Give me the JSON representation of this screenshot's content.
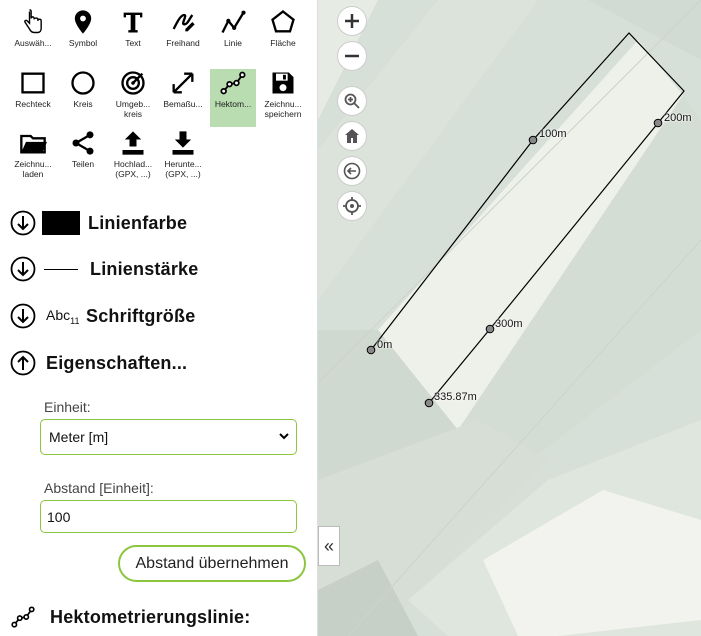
{
  "toolbar": {
    "tools": [
      {
        "id": "select",
        "label": "Auswäh...",
        "icon": "pointer-hand-icon"
      },
      {
        "id": "symbol",
        "label": "Symbol",
        "icon": "map-pin-icon"
      },
      {
        "id": "text",
        "label": "Text",
        "icon": "text-t-icon"
      },
      {
        "id": "freehand",
        "label": "Freihand",
        "icon": "freehand-icon"
      },
      {
        "id": "line",
        "label": "Linie",
        "icon": "polyline-icon"
      },
      {
        "id": "area",
        "label": "Fläche",
        "icon": "polygon-icon"
      },
      {
        "id": "rectangle",
        "label": "Rechteck",
        "icon": "rectangle-icon"
      },
      {
        "id": "circle",
        "label": "Kreis",
        "icon": "circle-icon"
      },
      {
        "id": "surrounding_circle",
        "label": "Umgeb... kreis",
        "icon": "target-icon"
      },
      {
        "id": "dimension",
        "label": "Bemaßu...",
        "icon": "dimension-arrow-icon"
      },
      {
        "id": "hectometer",
        "label": "Hektom...",
        "icon": "hectometer-line-icon",
        "active": true
      },
      {
        "id": "save_drawing",
        "label": "Zeichnu... speichern",
        "icon": "save-icon"
      },
      {
        "id": "load_drawing",
        "label": "Zeichnu... laden",
        "icon": "folder-icon"
      },
      {
        "id": "share",
        "label": "Teilen",
        "icon": "share-icon"
      },
      {
        "id": "upload",
        "label": "Hochlad... (GPX, ...)",
        "icon": "upload-icon"
      },
      {
        "id": "download",
        "label": "Herunte... (GPX, ...)",
        "icon": "download-icon"
      }
    ]
  },
  "sections": {
    "line_color": "Linienfarbe",
    "line_width": "Linienstärke",
    "font_size": "Schriftgröße",
    "font_size_sample": "Abc",
    "font_size_sub": "11",
    "properties": "Eigenschaften..."
  },
  "form": {
    "unit_label": "Einheit:",
    "unit_value": "Meter [m]",
    "distance_label": "Abstand [Einheit]:",
    "distance_value": "100",
    "apply_button": "Abstand übernehmen"
  },
  "hectometer_section_title": "Hektometrierungslinie:",
  "map": {
    "markers": [
      "0m",
      "100m",
      "200m",
      "300m",
      "335.87m"
    ],
    "collapse_label": "«"
  },
  "colors": {
    "accent_green": "#8cc63f",
    "active_tool": "#b9dcb1",
    "line_color": "#000000"
  }
}
